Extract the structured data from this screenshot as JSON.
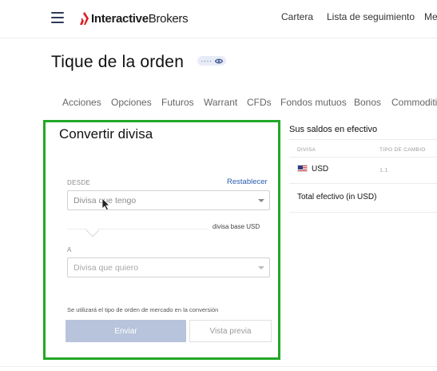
{
  "brand": {
    "name_bold": "Interactive",
    "name_light": "Brokers",
    "accent_color": "#d81e22"
  },
  "topnav": {
    "items": [
      "Cartera",
      "Lista de seguimiento",
      "Me"
    ]
  },
  "page": {
    "title": "Tique de la orden",
    "pill_dots": "····"
  },
  "tabs": [
    "Acciones",
    "Opciones",
    "Futuros",
    "Warrant",
    "CFDs",
    "Fondos mutuos",
    "Bonos",
    "Commoditi"
  ],
  "convert": {
    "title": "Convertir divisa",
    "border_color": "#21a826",
    "from_label": "DESDE",
    "reset_label": "Restablecer",
    "from_placeholder": "Divisa que tengo",
    "base_note": "divisa base USD",
    "to_label": "A",
    "to_placeholder": "Divisa que quiero",
    "conversion_note": "Se utilizará el tipo de orden de mercado en la conversión",
    "submit_label": "Enviar",
    "preview_label": "Vista previa"
  },
  "balances": {
    "title": "Sus saldos en efectivo",
    "col_currency": "DIVISA",
    "col_rate": "TIPO DE CAMBIO",
    "rows": [
      {
        "currency": "USD",
        "rate": "1.1",
        "flag": "us-flag-icon"
      }
    ],
    "total_label": "Total efectivo (in USD)"
  },
  "icons": {
    "menu": "hamburger-menu-icon",
    "eye": "eye-icon",
    "caret": "chevron-down-icon",
    "cursor": "mouse-cursor-icon"
  }
}
